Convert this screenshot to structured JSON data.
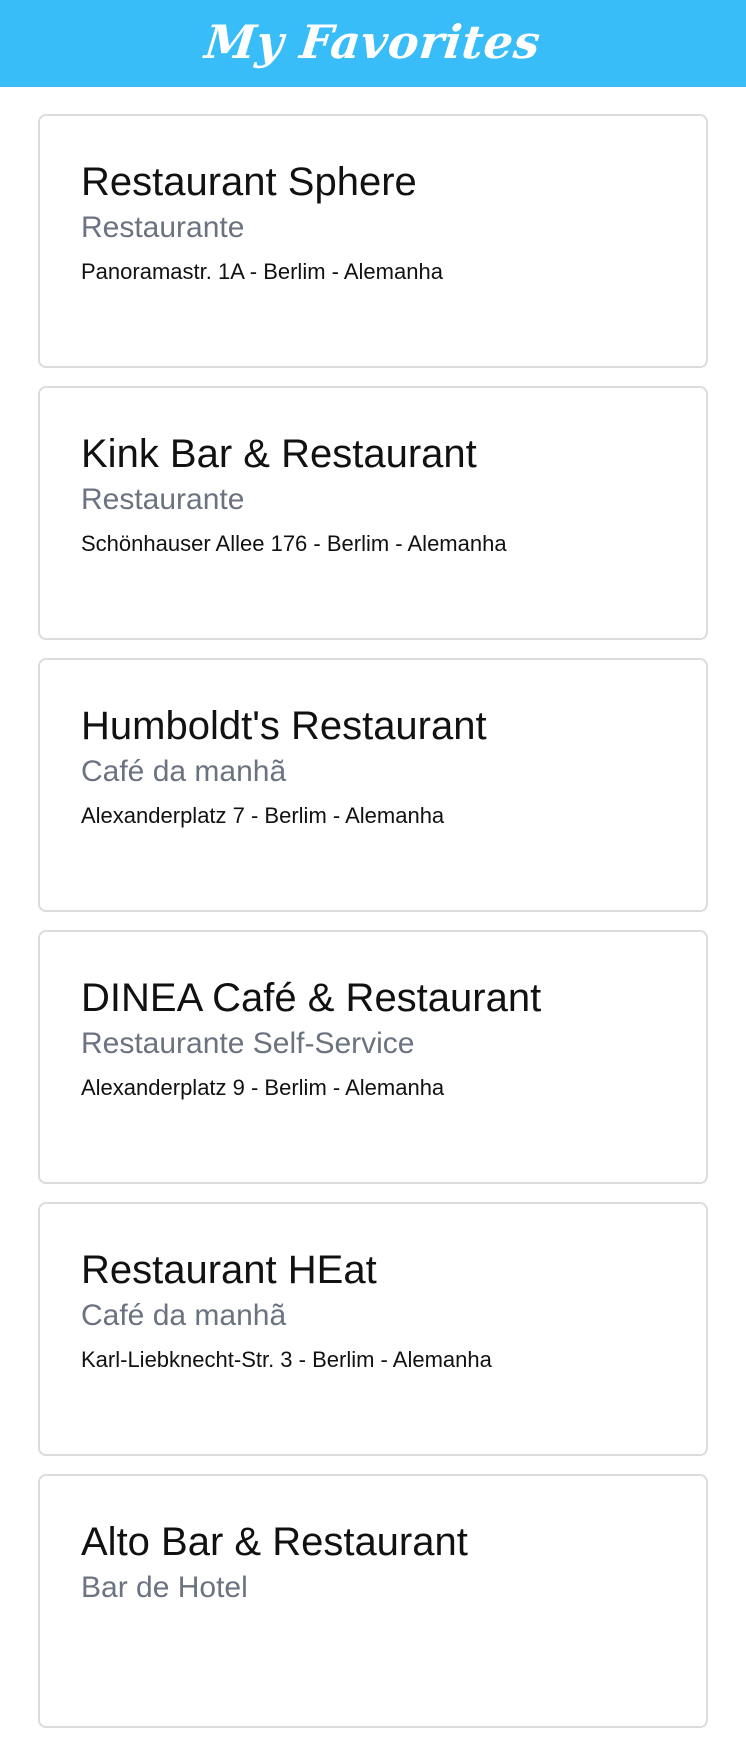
{
  "header": {
    "title": "My Favorites"
  },
  "favorites": [
    {
      "name": "Restaurant Sphere",
      "category": "Restaurante",
      "address": "Panoramastr. 1A - Berlim - Alemanha"
    },
    {
      "name": "Kink Bar & Restaurant",
      "category": "Restaurante",
      "address": "Schönhauser Allee 176 - Berlim - Alemanha"
    },
    {
      "name": "Humboldt's Restaurant",
      "category": "Café da manhã",
      "address": "Alexanderplatz 7 - Berlim - Alemanha"
    },
    {
      "name": "DINEA Café & Restaurant",
      "category": "Restaurante Self-Service",
      "address": "Alexanderplatz 9 - Berlim - Alemanha"
    },
    {
      "name": "Restaurant HEat",
      "category": "Café da manhã",
      "address": "Karl-Liebknecht-Str. 3 - Berlim - Alemanha"
    },
    {
      "name": "Alto Bar & Restaurant",
      "category": "Bar de Hotel"
    }
  ],
  "colors": {
    "header_background": "#38bdf8",
    "category_text": "#6b7280",
    "card_border": "#dcdcdc"
  }
}
